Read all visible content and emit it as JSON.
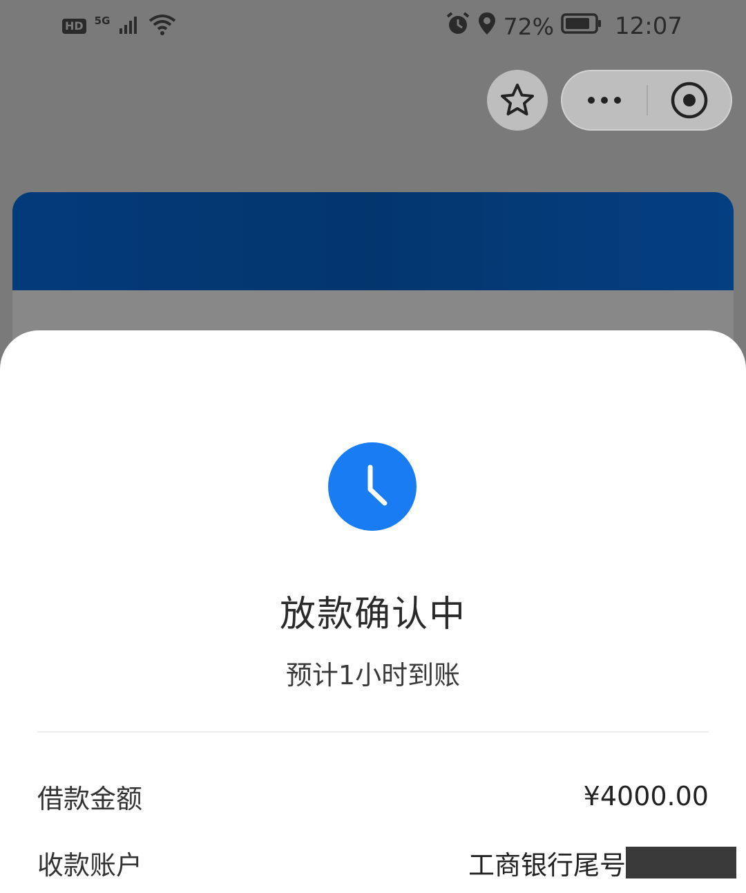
{
  "status_bar": {
    "hd": "HD",
    "network": "5G",
    "battery": "72%",
    "time": "12:07"
  },
  "sheet": {
    "title": "放款确认中",
    "subtitle": "预计1小时到账",
    "rows": [
      {
        "label": "借款金额",
        "value": "¥4000.00"
      },
      {
        "label": "收款账户",
        "value": "工商银行尾号"
      }
    ]
  },
  "colors": {
    "accent_blue": "#1a7cf2",
    "banner_blue": "#033a7a",
    "overlay_gray": "#7a7a7a"
  },
  "icons": [
    "signal-icon",
    "wifi-icon",
    "alarm-icon",
    "location-icon",
    "battery-icon",
    "star-icon",
    "more-icon",
    "close-target-icon",
    "clock-icon"
  ]
}
